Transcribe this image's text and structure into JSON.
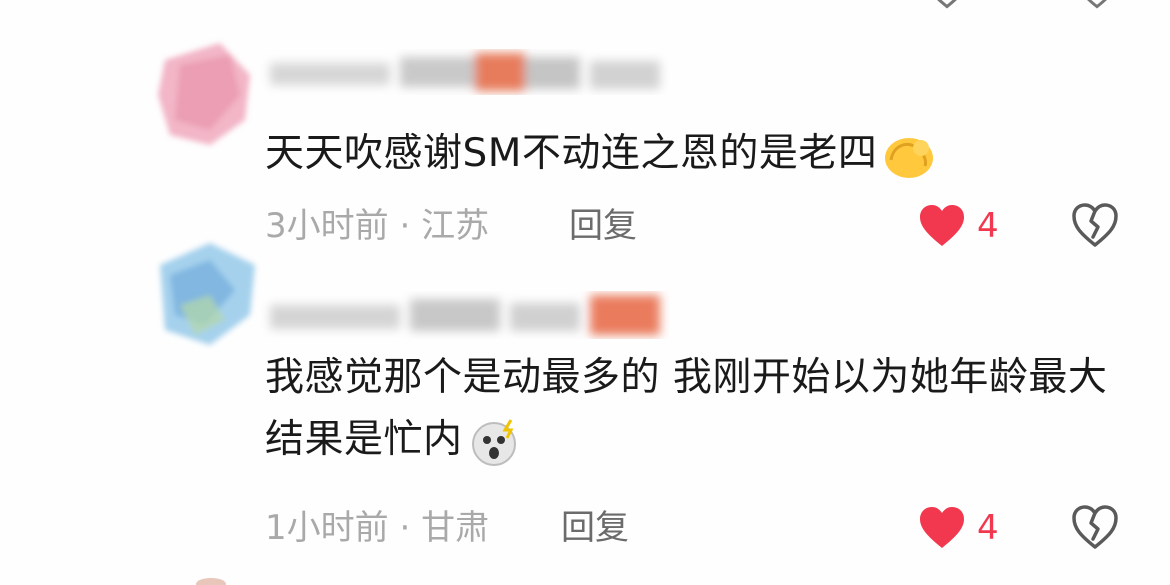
{
  "comments": [
    {
      "text": "天天吹感谢SM不动连之恩的是老四",
      "emoji": "flexed-biceps-emoji",
      "time": "3小时前",
      "location": "江苏",
      "meta_separator": " · ",
      "reply_label": "回复",
      "likes": "4",
      "liked": true
    },
    {
      "text": "我感觉那个是动最多的 我刚开始以为她年龄最大结果是忙内",
      "emoji": "shocked-face-emoji",
      "time": "1小时前",
      "location": "甘肃",
      "meta_separator": " · ",
      "reply_label": "回复",
      "likes": "4",
      "liked": true
    }
  ],
  "colors": {
    "like_red": "#f2384f",
    "meta_gray": "#a9a9a9",
    "reply_gray": "#6b6b6b",
    "text_dark": "#1a1a1a"
  }
}
